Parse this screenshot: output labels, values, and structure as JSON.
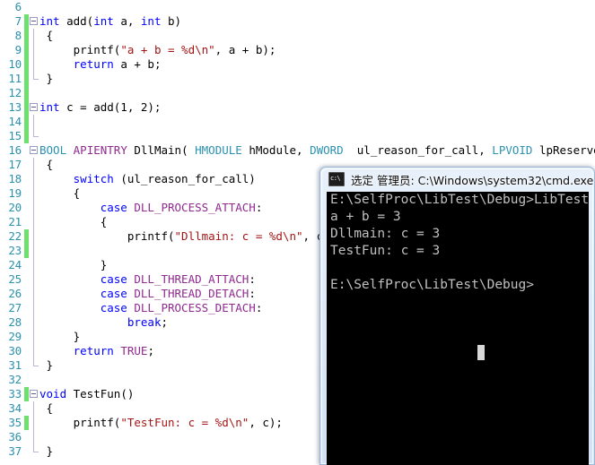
{
  "editor": {
    "name": "code-editor",
    "language": "C++",
    "gutter_color": "#2b91af",
    "change_bar_color": "#6cdf6c",
    "lines": [
      {
        "num": "6",
        "change": false,
        "fold": "none",
        "indent": 0,
        "tokens": []
      },
      {
        "num": "7",
        "change": true,
        "fold": "open",
        "indent": 0,
        "tokens": [
          {
            "t": "int",
            "c": "kw"
          },
          {
            "t": " add(",
            "c": ""
          },
          {
            "t": "int",
            "c": "kw"
          },
          {
            "t": " a, ",
            "c": ""
          },
          {
            "t": "int",
            "c": "kw"
          },
          {
            "t": " b)",
            "c": ""
          }
        ]
      },
      {
        "num": "8",
        "change": true,
        "fold": "bar",
        "indent": 0,
        "tokens": [
          {
            "t": " {",
            "c": ""
          }
        ]
      },
      {
        "num": "9",
        "change": true,
        "fold": "bar",
        "indent": 0,
        "tokens": [
          {
            "t": "     printf(",
            "c": ""
          },
          {
            "t": "\"a + b = %d\\n\"",
            "c": "str"
          },
          {
            "t": ", a + b);",
            "c": ""
          }
        ]
      },
      {
        "num": "10",
        "change": true,
        "fold": "bar",
        "indent": 0,
        "tokens": [
          {
            "t": "     ",
            "c": ""
          },
          {
            "t": "return",
            "c": "kw"
          },
          {
            "t": " a + b;",
            "c": ""
          }
        ]
      },
      {
        "num": "11",
        "change": true,
        "fold": "tail",
        "indent": 0,
        "tokens": [
          {
            "t": " }",
            "c": ""
          }
        ]
      },
      {
        "num": "12",
        "change": true,
        "fold": "none",
        "indent": 0,
        "tokens": []
      },
      {
        "num": "13",
        "change": true,
        "fold": "open",
        "indent": 0,
        "tokens": [
          {
            "t": "int",
            "c": "kw"
          },
          {
            "t": " c = add(1, 2);",
            "c": ""
          }
        ]
      },
      {
        "num": "14",
        "change": true,
        "fold": "bar",
        "indent": 0,
        "tokens": []
      },
      {
        "num": "15",
        "change": true,
        "fold": "tail",
        "indent": 0,
        "tokens": []
      },
      {
        "num": "16",
        "change": false,
        "fold": "open",
        "indent": 0,
        "tokens": [
          {
            "t": "BOOL",
            "c": "typ"
          },
          {
            "t": " ",
            "c": ""
          },
          {
            "t": "APIENTRY",
            "c": "mac"
          },
          {
            "t": " DllMain( ",
            "c": ""
          },
          {
            "t": "HMODULE",
            "c": "typ"
          },
          {
            "t": " hModule, ",
            "c": ""
          },
          {
            "t": "DWORD",
            "c": "typ"
          },
          {
            "t": "  ul_reason_for_call, ",
            "c": ""
          },
          {
            "t": "LPVOID",
            "c": "typ"
          },
          {
            "t": " lpReserved)",
            "c": ""
          }
        ]
      },
      {
        "num": "17",
        "change": false,
        "fold": "bar",
        "indent": 0,
        "tokens": [
          {
            "t": " {",
            "c": ""
          }
        ]
      },
      {
        "num": "18",
        "change": false,
        "fold": "bar",
        "indent": 0,
        "tokens": [
          {
            "t": "     ",
            "c": ""
          },
          {
            "t": "switch",
            "c": "kw"
          },
          {
            "t": " (ul_reason_for_call)",
            "c": ""
          }
        ]
      },
      {
        "num": "19",
        "change": false,
        "fold": "bar",
        "indent": 0,
        "tokens": [
          {
            "t": "     {",
            "c": ""
          }
        ]
      },
      {
        "num": "20",
        "change": false,
        "fold": "bar",
        "indent": 0,
        "tokens": [
          {
            "t": "         ",
            "c": ""
          },
          {
            "t": "case",
            "c": "kw"
          },
          {
            "t": " ",
            "c": ""
          },
          {
            "t": "DLL_PROCESS_ATTACH",
            "c": "mac"
          },
          {
            "t": ":",
            "c": ""
          }
        ]
      },
      {
        "num": "21",
        "change": false,
        "fold": "bar",
        "indent": 0,
        "tokens": [
          {
            "t": "         {",
            "c": ""
          }
        ]
      },
      {
        "num": "22",
        "change": true,
        "fold": "bar",
        "indent": 0,
        "tokens": [
          {
            "t": "             printf(",
            "c": ""
          },
          {
            "t": "\"Dllmain: c = %d\\n\"",
            "c": "str"
          },
          {
            "t": ", c);",
            "c": ""
          }
        ]
      },
      {
        "num": "23",
        "change": true,
        "fold": "bar",
        "indent": 0,
        "tokens": []
      },
      {
        "num": "24",
        "change": false,
        "fold": "bar",
        "indent": 0,
        "tokens": [
          {
            "t": "         }",
            "c": ""
          }
        ]
      },
      {
        "num": "25",
        "change": false,
        "fold": "bar",
        "indent": 0,
        "tokens": [
          {
            "t": "         ",
            "c": ""
          },
          {
            "t": "case",
            "c": "kw"
          },
          {
            "t": " ",
            "c": ""
          },
          {
            "t": "DLL_THREAD_ATTACH",
            "c": "mac"
          },
          {
            "t": ":",
            "c": ""
          }
        ]
      },
      {
        "num": "26",
        "change": false,
        "fold": "bar",
        "indent": 0,
        "tokens": [
          {
            "t": "         ",
            "c": ""
          },
          {
            "t": "case",
            "c": "kw"
          },
          {
            "t": " ",
            "c": ""
          },
          {
            "t": "DLL_THREAD_DETACH",
            "c": "mac"
          },
          {
            "t": ":",
            "c": ""
          }
        ]
      },
      {
        "num": "27",
        "change": false,
        "fold": "bar",
        "indent": 0,
        "tokens": [
          {
            "t": "         ",
            "c": ""
          },
          {
            "t": "case",
            "c": "kw"
          },
          {
            "t": " ",
            "c": ""
          },
          {
            "t": "DLL_PROCESS_DETACH",
            "c": "mac"
          },
          {
            "t": ":",
            "c": ""
          }
        ]
      },
      {
        "num": "28",
        "change": false,
        "fold": "bar",
        "indent": 0,
        "tokens": [
          {
            "t": "             ",
            "c": ""
          },
          {
            "t": "break",
            "c": "kw"
          },
          {
            "t": ";",
            "c": ""
          }
        ]
      },
      {
        "num": "29",
        "change": false,
        "fold": "bar",
        "indent": 0,
        "tokens": [
          {
            "t": "     }",
            "c": ""
          }
        ]
      },
      {
        "num": "30",
        "change": false,
        "fold": "bar",
        "indent": 0,
        "tokens": [
          {
            "t": "     ",
            "c": ""
          },
          {
            "t": "return",
            "c": "kw"
          },
          {
            "t": " ",
            "c": ""
          },
          {
            "t": "TRUE",
            "c": "mac"
          },
          {
            "t": ";",
            "c": ""
          }
        ]
      },
      {
        "num": "31",
        "change": false,
        "fold": "tail",
        "indent": 0,
        "tokens": [
          {
            "t": " }",
            "c": ""
          }
        ]
      },
      {
        "num": "32",
        "change": false,
        "fold": "none",
        "indent": 0,
        "tokens": []
      },
      {
        "num": "33",
        "change": true,
        "fold": "open",
        "indent": 0,
        "tokens": [
          {
            "t": "void",
            "c": "kw"
          },
          {
            "t": " TestFun()",
            "c": ""
          }
        ]
      },
      {
        "num": "34",
        "change": false,
        "fold": "bar",
        "indent": 0,
        "tokens": [
          {
            "t": " {",
            "c": ""
          }
        ]
      },
      {
        "num": "35",
        "change": true,
        "fold": "bar",
        "indent": 0,
        "tokens": [
          {
            "t": "     printf(",
            "c": ""
          },
          {
            "t": "\"TestFun: c = %d\\n\"",
            "c": "str"
          },
          {
            "t": ", c);",
            "c": ""
          }
        ]
      },
      {
        "num": "36",
        "change": false,
        "fold": "bar",
        "indent": 0,
        "tokens": []
      },
      {
        "num": "37",
        "change": false,
        "fold": "tail",
        "indent": 0,
        "tokens": [
          {
            "t": " }",
            "c": ""
          }
        ]
      }
    ]
  },
  "console": {
    "window_name": "command-prompt-window",
    "title": "选定 管理员: C:\\Windows\\system32\\cmd.exe",
    "icon": "cmd-icon",
    "background": "#000000",
    "foreground": "#c0c0c0",
    "lines": [
      "E:\\SelfProc\\LibTest\\Debug>LibTest.exe",
      "a + b = 3",
      "Dllmain: c = 3",
      "TestFun: c = 3",
      "",
      "E:\\SelfProc\\LibTest\\Debug>",
      "",
      ""
    ],
    "cursor_visible": true
  }
}
